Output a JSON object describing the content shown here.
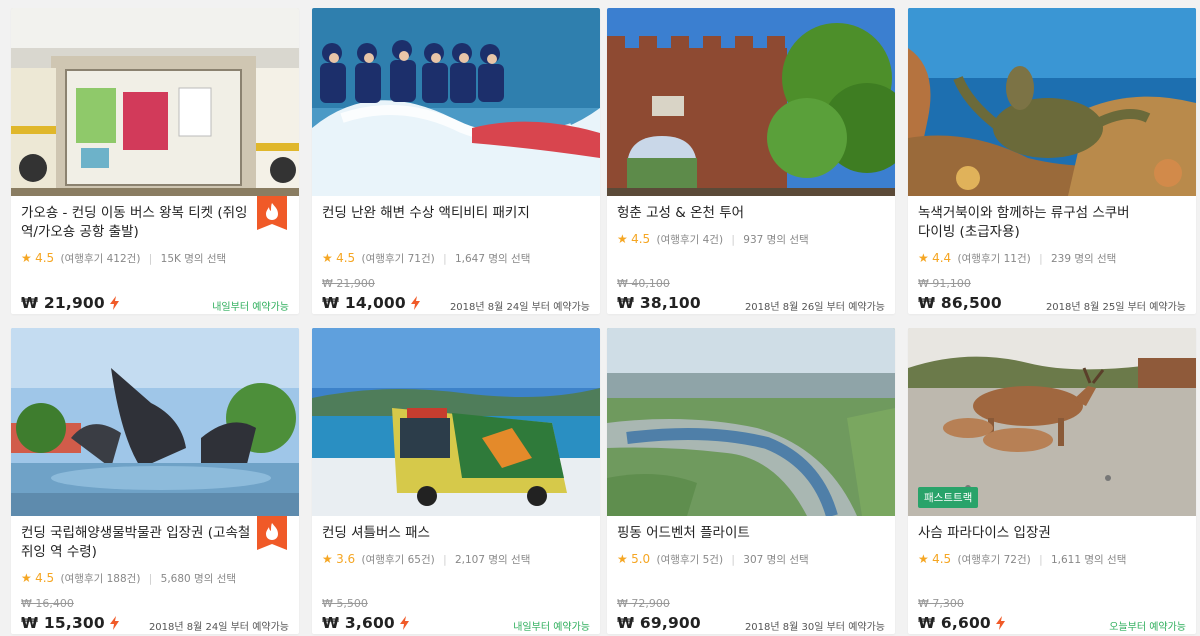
{
  "products": [
    {
      "title": "가오숑 - 컨딩 이동 버스 왕복 티켓 (쥐잉 역/가오숑 공항 출발)",
      "rating": "4.5",
      "reviews": "(여행후기 412건)",
      "booked": "15K 명의 선택",
      "old_price": "",
      "price": "₩ 21,900",
      "availability": "내일부터 예약가능",
      "availability_color": "green",
      "hot": true,
      "badge": ""
    },
    {
      "title": "컨딩 난완 해변 수상 액티비티 패키지",
      "rating": "4.5",
      "reviews": "(여행후기 71건)",
      "booked": "1,647 명의 선택",
      "old_price": "₩ 21,900",
      "price": "₩ 14,000",
      "availability": "2018년 8월 24일 부터 예약가능",
      "availability_color": "gray",
      "hot": false,
      "badge": ""
    },
    {
      "title": "헝춘 고성 & 온천 투어",
      "rating": "4.5",
      "reviews": "(여행후기 4건)",
      "booked": "937 명의 선택",
      "old_price": "₩ 40,100",
      "price": "₩ 38,100",
      "availability": "2018년 8월 26일 부터 예약가능",
      "availability_color": "gray",
      "hot": false,
      "badge": ""
    },
    {
      "title": "녹색거북이와 함께하는 류구섬 스쿠버 다이빙 (초급자용)",
      "rating": "4.4",
      "reviews": "(여행후기 11건)",
      "booked": "239 명의 선택",
      "old_price": "₩ 91,100",
      "price": "₩ 86,500",
      "availability": "2018년 8월 25일 부터 예약가능",
      "availability_color": "gray",
      "hot": false,
      "badge": ""
    },
    {
      "title": "컨딩 국립해양생물박물관 입장권 (고속철 쥐잉 역 수령)",
      "rating": "4.5",
      "reviews": "(여행후기 188건)",
      "booked": "5,680 명의 선택",
      "old_price": "₩ 16,400",
      "price": "₩ 15,300",
      "availability": "2018년 8월 24일 부터 예약가능",
      "availability_color": "gray",
      "hot": true,
      "badge": ""
    },
    {
      "title": "컨딩 셔틀버스 패스",
      "rating": "3.6",
      "reviews": "(여행후기 65건)",
      "booked": "2,107 명의 선택",
      "old_price": "₩ 5,500",
      "price": "₩ 3,600",
      "availability": "내일부터 예약가능",
      "availability_color": "green",
      "hot": false,
      "badge": ""
    },
    {
      "title": "핑동 어드벤처 플라이트",
      "rating": "5.0",
      "reviews": "(여행후기 5건)",
      "booked": "307 명의 선택",
      "old_price": "₩ 72,900",
      "price": "₩ 69,900",
      "availability": "2018년 8월 30일 부터 예약가능",
      "availability_color": "gray",
      "hot": false,
      "badge": ""
    },
    {
      "title": "사슴 파라다이스 입장권",
      "rating": "4.5",
      "reviews": "(여행후기 72건)",
      "booked": "1,611 명의 선택",
      "old_price": "₩ 7,300",
      "price": "₩ 6,600",
      "availability": "오늘부터 예약가능",
      "availability_color": "green",
      "hot": false,
      "badge": "패스트트랙"
    }
  ],
  "colors": {
    "star": "#f5a623",
    "bolt": "#f05a28",
    "hot_badge": "#f05a28",
    "green": "#2fae5c",
    "fast_badge": "#29a36a"
  },
  "icons": {
    "rating": "star-icon",
    "instant": "lightning-bolt-icon",
    "hot": "fire-icon"
  }
}
